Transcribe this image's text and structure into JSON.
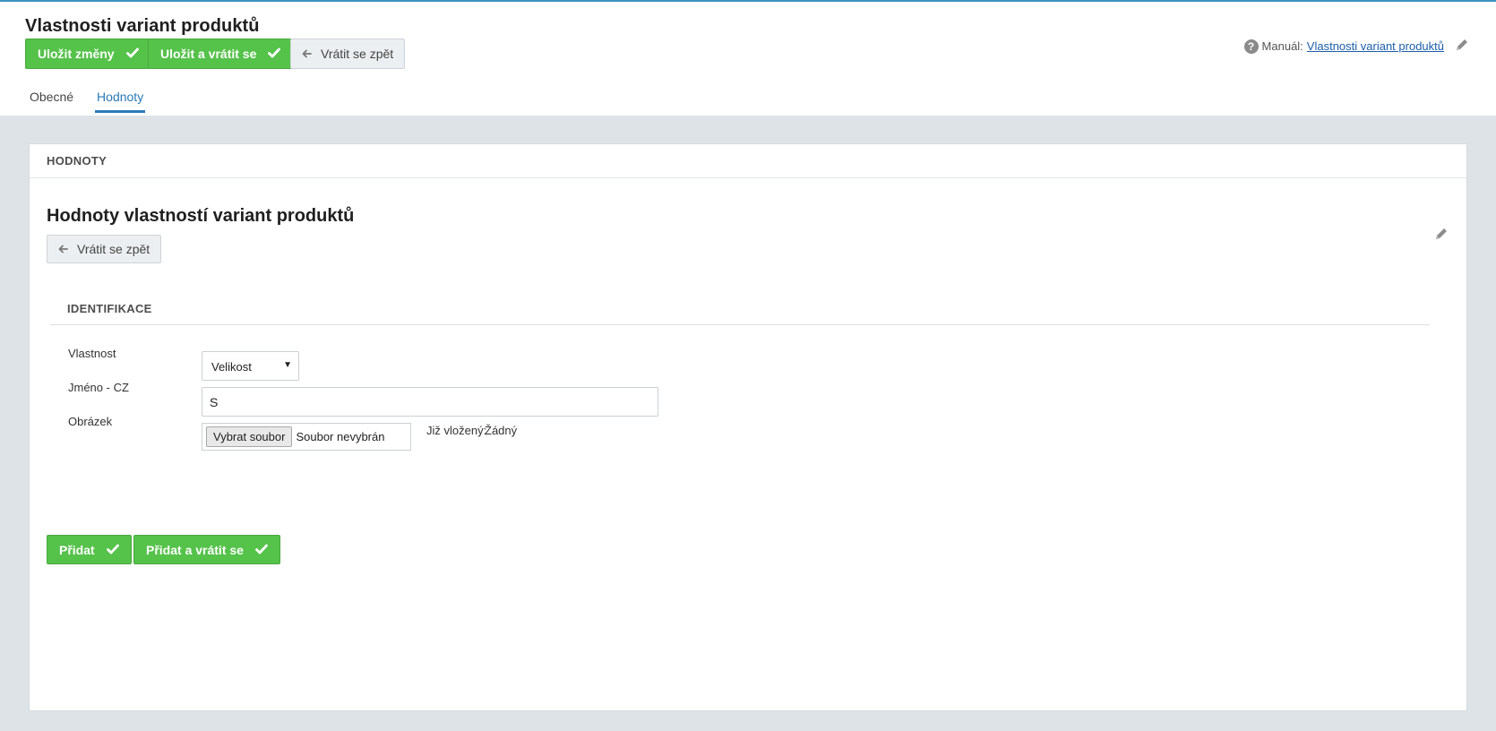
{
  "header": {
    "title": "Vlastnosti variant produktů",
    "save_label": "Uložit změny",
    "save_return_label": "Uložit a vrátit se",
    "back_label": "Vrátit se zpět",
    "manual_prefix": "Manuál:",
    "manual_link": "Vlastnosti variant produktů",
    "tabs": [
      {
        "label": "Obecné",
        "active": false
      },
      {
        "label": "Hodnoty",
        "active": true
      }
    ]
  },
  "panel": {
    "heading": "HODNOTY",
    "title": "Hodnoty vlastností variant produktů",
    "back_label": "Vrátit se zpět",
    "section_heading": "IDENTIFIKACE",
    "fields": {
      "property_label": "Vlastnost",
      "property_value": "Velikost",
      "name_label": "Jméno - CZ",
      "name_value": "S",
      "image_label": "Obrázek",
      "file_button": "Vybrat soubor",
      "file_status": "Soubor nevybrán",
      "existing_label": "Již vložený:",
      "existing_value": "Žádný"
    },
    "add_label": "Přidat",
    "add_return_label": "Přidat a vrátit se"
  },
  "colors": {
    "accent_green": "#55c24a",
    "tab_active": "#2a7ab5",
    "link": "#1b5ea8",
    "background": "#dde3e6"
  }
}
